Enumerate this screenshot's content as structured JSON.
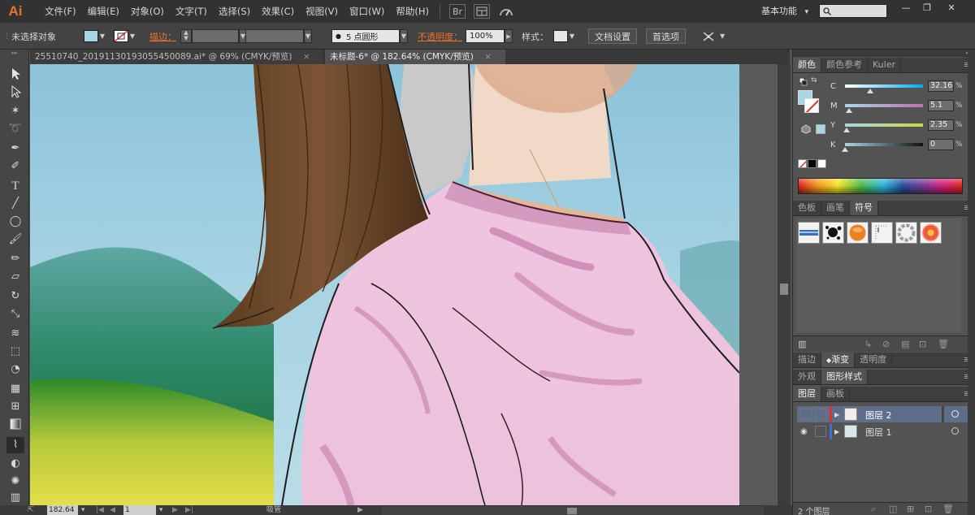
{
  "app": {
    "logo": "Ai"
  },
  "menu": [
    "文件(F)",
    "编辑(E)",
    "对象(O)",
    "文字(T)",
    "选择(S)",
    "效果(C)",
    "视图(V)",
    "窗口(W)",
    "帮助(H)"
  ],
  "menubar_icons": {
    "bridge": "Br"
  },
  "workspace": {
    "label": "基本功能",
    "arrow": "▾"
  },
  "search": {
    "value": ""
  },
  "window_controls": {
    "minimize": "—",
    "restore": "❐",
    "close": "✕"
  },
  "control": {
    "selection_label": "未选择对象",
    "stroke_label": "描边：",
    "stroke_value": "",
    "brush_value": "5 点圆形",
    "opacity_label": "不透明度：",
    "opacity_value": "100%",
    "style_label": "样式：",
    "doc_settings_btn": "文档设置",
    "preferences_btn": "首选项"
  },
  "tabs": [
    {
      "title": "25510740_20191130193055450089.ai* @ 69% (CMYK/预览)",
      "close": "×",
      "active": false
    },
    {
      "title": "未标题-6* @ 182.64% (CMYK/预览)",
      "close": "×",
      "active": true
    }
  ],
  "status": {
    "zoom": "182.64",
    "artboard": "1",
    "tool": "吸管"
  },
  "color_panel": {
    "tabs": [
      "颜色",
      "颜色参考",
      "Kuler"
    ],
    "channels": [
      {
        "name": "C",
        "value": "32.16",
        "fraction": 0.32
      },
      {
        "name": "M",
        "value": "5.1",
        "fraction": 0.05
      },
      {
        "name": "Y",
        "value": "2.35",
        "fraction": 0.02
      },
      {
        "name": "K",
        "value": "0",
        "fraction": 0.0
      }
    ],
    "unit": "%"
  },
  "swatch_panel": {
    "tabs": [
      "色板",
      "画笔",
      "符号"
    ],
    "symbols": [
      "banner-symbol",
      "ink-splash-symbol",
      "orange-ball-symbol",
      "dotted-frame-symbol",
      "ring-symbol",
      "flower-symbol"
    ]
  },
  "stroke_panel": {
    "tabs": [
      "描边",
      "渐变",
      "透明度"
    ]
  },
  "appearance_panel": {
    "tabs": [
      "外观",
      "图形样式"
    ]
  },
  "layers_panel": {
    "tabs": [
      "图层",
      "画板"
    ],
    "layers": [
      {
        "name": "图层 2",
        "selected": true
      },
      {
        "name": "图层 1",
        "selected": false
      }
    ],
    "footer": "2 个图层"
  },
  "colors": {
    "accent": "#e8732a",
    "fill": "#a9d6e4",
    "sky": "#8fc6dc",
    "shirt": "#efc6de",
    "hair": "#6e4a2a",
    "skin": "#f2d8c4"
  }
}
